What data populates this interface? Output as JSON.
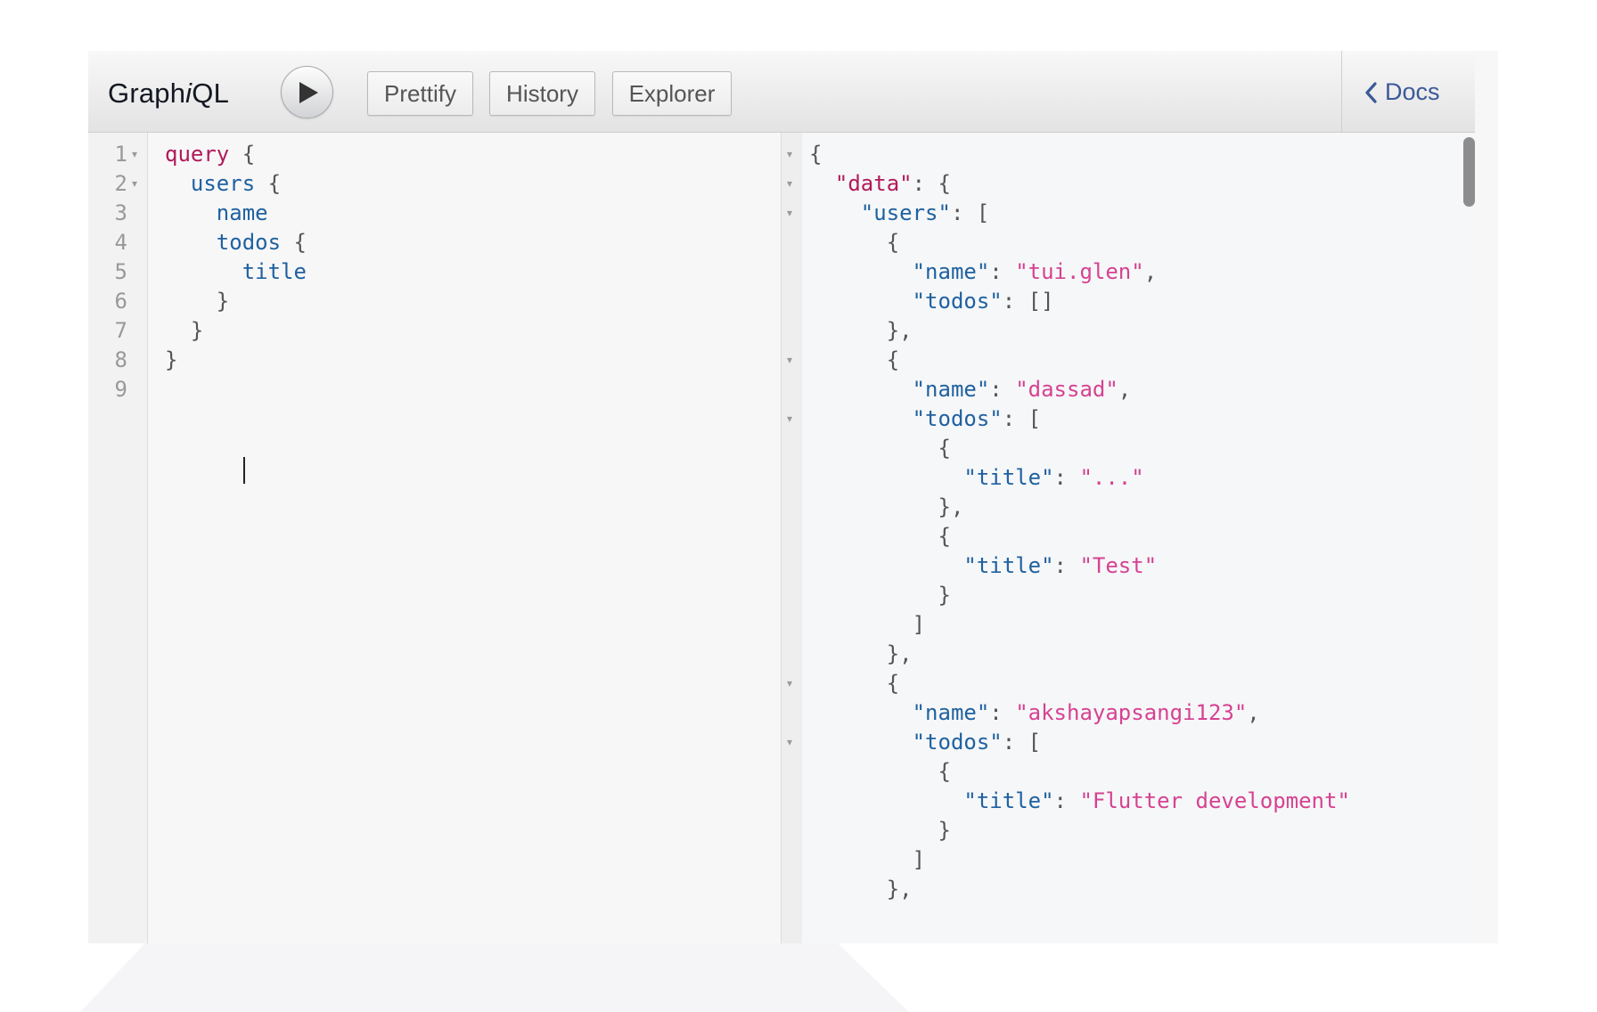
{
  "app": {
    "title_prefix": "Graph",
    "title_italic": "i",
    "title_suffix": "QL"
  },
  "toolbar": {
    "run_icon": "play-icon",
    "prettify_label": "Prettify",
    "history_label": "History",
    "explorer_label": "Explorer",
    "docs_label": "Docs",
    "docs_icon": "chevron-left-icon"
  },
  "colors": {
    "keyword": "#b11a5a",
    "field": "#1f61a0",
    "string": "#d64292",
    "docs_link": "#3b5998"
  },
  "query_editor": {
    "line_numbers": [
      "1",
      "2",
      "3",
      "4",
      "5",
      "6",
      "7",
      "8",
      "9"
    ],
    "lines": [
      {
        "indent": 0,
        "tokens": [
          {
            "t": "kw",
            "v": "query"
          },
          {
            "t": "pun",
            "v": " {"
          }
        ]
      },
      {
        "indent": 1,
        "tokens": [
          {
            "t": "fld",
            "v": "users"
          },
          {
            "t": "pun",
            "v": " {"
          }
        ]
      },
      {
        "indent": 2,
        "tokens": [
          {
            "t": "fld",
            "v": "name"
          }
        ]
      },
      {
        "indent": 2,
        "tokens": [
          {
            "t": "fld",
            "v": "todos"
          },
          {
            "t": "pun",
            "v": " {"
          }
        ]
      },
      {
        "indent": 3,
        "tokens": [
          {
            "t": "fld",
            "v": "title"
          }
        ]
      },
      {
        "indent": 2,
        "tokens": [
          {
            "t": "pun",
            "v": "}"
          }
        ]
      },
      {
        "indent": 1,
        "tokens": [
          {
            "t": "pun",
            "v": "}"
          }
        ]
      },
      {
        "indent": 0,
        "tokens": [
          {
            "t": "pun",
            "v": "}"
          }
        ]
      },
      {
        "indent": 0,
        "tokens": []
      }
    ],
    "folded_lines": [
      0,
      1
    ]
  },
  "result_viewer": {
    "lines": [
      {
        "indent": 0,
        "fold": true,
        "tokens": [
          {
            "t": "pun",
            "v": "{"
          }
        ]
      },
      {
        "indent": 1,
        "fold": true,
        "tokens": [
          {
            "t": "rootkey",
            "v": "\"data\""
          },
          {
            "t": "pun",
            "v": ": {"
          }
        ]
      },
      {
        "indent": 2,
        "fold": true,
        "tokens": [
          {
            "t": "key",
            "v": "\"users\""
          },
          {
            "t": "pun",
            "v": ": ["
          }
        ]
      },
      {
        "indent": 3,
        "fold": false,
        "tokens": [
          {
            "t": "pun",
            "v": "{"
          }
        ]
      },
      {
        "indent": 4,
        "fold": false,
        "tokens": [
          {
            "t": "key",
            "v": "\"name\""
          },
          {
            "t": "pun",
            "v": ": "
          },
          {
            "t": "str",
            "v": "\"tui.glen\""
          },
          {
            "t": "pun",
            "v": ","
          }
        ]
      },
      {
        "indent": 4,
        "fold": false,
        "tokens": [
          {
            "t": "key",
            "v": "\"todos\""
          },
          {
            "t": "pun",
            "v": ": []"
          }
        ]
      },
      {
        "indent": 3,
        "fold": false,
        "tokens": [
          {
            "t": "pun",
            "v": "},"
          }
        ]
      },
      {
        "indent": 3,
        "fold": true,
        "tokens": [
          {
            "t": "pun",
            "v": "{"
          }
        ]
      },
      {
        "indent": 4,
        "fold": false,
        "tokens": [
          {
            "t": "key",
            "v": "\"name\""
          },
          {
            "t": "pun",
            "v": ": "
          },
          {
            "t": "str",
            "v": "\"dassad\""
          },
          {
            "t": "pun",
            "v": ","
          }
        ]
      },
      {
        "indent": 4,
        "fold": true,
        "tokens": [
          {
            "t": "key",
            "v": "\"todos\""
          },
          {
            "t": "pun",
            "v": ": ["
          }
        ]
      },
      {
        "indent": 5,
        "fold": false,
        "tokens": [
          {
            "t": "pun",
            "v": "{"
          }
        ]
      },
      {
        "indent": 6,
        "fold": false,
        "tokens": [
          {
            "t": "key",
            "v": "\"title\""
          },
          {
            "t": "pun",
            "v": ": "
          },
          {
            "t": "str",
            "v": "\"...\""
          }
        ]
      },
      {
        "indent": 5,
        "fold": false,
        "tokens": [
          {
            "t": "pun",
            "v": "},"
          }
        ]
      },
      {
        "indent": 5,
        "fold": false,
        "tokens": [
          {
            "t": "pun",
            "v": "{"
          }
        ]
      },
      {
        "indent": 6,
        "fold": false,
        "tokens": [
          {
            "t": "key",
            "v": "\"title\""
          },
          {
            "t": "pun",
            "v": ": "
          },
          {
            "t": "str",
            "v": "\"Test\""
          }
        ]
      },
      {
        "indent": 5,
        "fold": false,
        "tokens": [
          {
            "t": "pun",
            "v": "}"
          }
        ]
      },
      {
        "indent": 4,
        "fold": false,
        "tokens": [
          {
            "t": "pun",
            "v": "]"
          }
        ]
      },
      {
        "indent": 3,
        "fold": false,
        "tokens": [
          {
            "t": "pun",
            "v": "},"
          }
        ]
      },
      {
        "indent": 3,
        "fold": true,
        "tokens": [
          {
            "t": "pun",
            "v": "{"
          }
        ]
      },
      {
        "indent": 4,
        "fold": false,
        "tokens": [
          {
            "t": "key",
            "v": "\"name\""
          },
          {
            "t": "pun",
            "v": ": "
          },
          {
            "t": "str",
            "v": "\"akshayapsangi123\""
          },
          {
            "t": "pun",
            "v": ","
          }
        ]
      },
      {
        "indent": 4,
        "fold": true,
        "tokens": [
          {
            "t": "key",
            "v": "\"todos\""
          },
          {
            "t": "pun",
            "v": ": ["
          }
        ]
      },
      {
        "indent": 5,
        "fold": false,
        "tokens": [
          {
            "t": "pun",
            "v": "{"
          }
        ]
      },
      {
        "indent": 6,
        "fold": false,
        "tokens": [
          {
            "t": "key",
            "v": "\"title\""
          },
          {
            "t": "pun",
            "v": ": "
          },
          {
            "t": "str",
            "v": "\"Flutter development\""
          }
        ]
      },
      {
        "indent": 5,
        "fold": false,
        "tokens": [
          {
            "t": "pun",
            "v": "}"
          }
        ]
      },
      {
        "indent": 4,
        "fold": false,
        "tokens": [
          {
            "t": "pun",
            "v": "]"
          }
        ]
      },
      {
        "indent": 3,
        "fold": false,
        "tokens": [
          {
            "t": "pun",
            "v": "},"
          }
        ]
      }
    ]
  }
}
